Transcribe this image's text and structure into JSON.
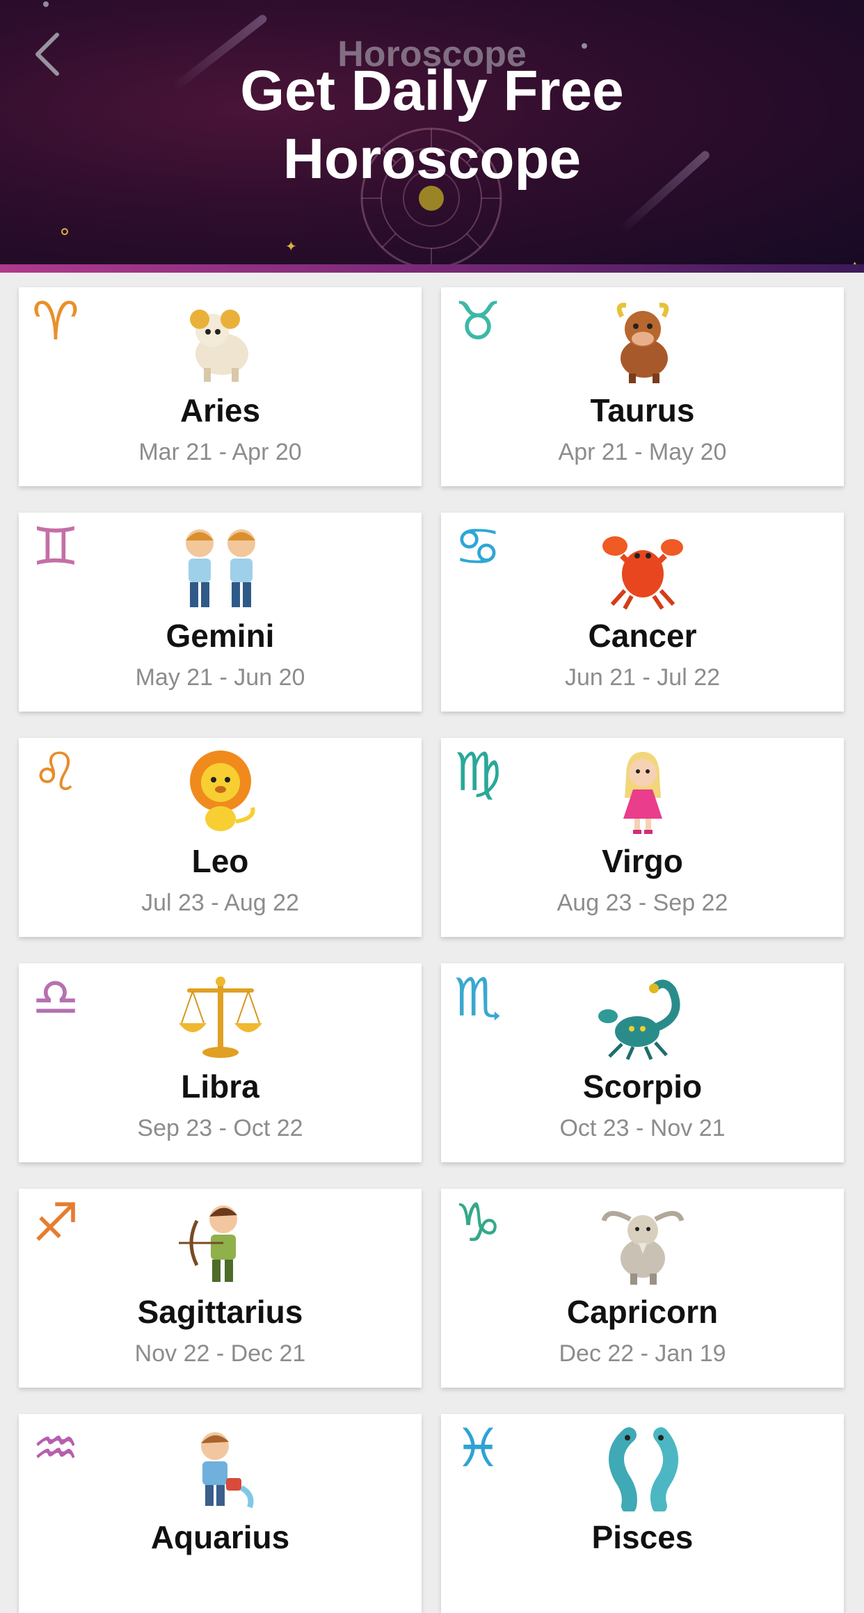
{
  "header": {
    "title": "Horoscope",
    "promo_line1": "Get Daily Free",
    "promo_line2": "Horoscope",
    "back_icon": "chevron-left-icon"
  },
  "signs": [
    {
      "name": "Aries",
      "dates": "Mar 21 - Apr 20",
      "symbol": "♈",
      "color": "#e8902a"
    },
    {
      "name": "Taurus",
      "dates": "Apr 21 - May 20",
      "symbol": "♉",
      "color": "#3db8a6"
    },
    {
      "name": "Gemini",
      "dates": "May 21 - Jun 20",
      "symbol": "♊",
      "color": "#c46fa6"
    },
    {
      "name": "Cancer",
      "dates": "Jun 21 - Jul 22",
      "symbol": "♋",
      "color": "#2ea6d6"
    },
    {
      "name": "Leo",
      "dates": "Jul 23 - Aug 22",
      "symbol": "♌",
      "color": "#e88c2a"
    },
    {
      "name": "Virgo",
      "dates": "Aug 23 - Sep 22",
      "symbol": "♍",
      "color": "#2aa898"
    },
    {
      "name": "Libra",
      "dates": "Sep 23 - Oct 22",
      "symbol": "♎",
      "color": "#b471b0"
    },
    {
      "name": "Scorpio",
      "dates": "Oct 23 - Nov 21",
      "symbol": "♏",
      "color": "#3aa8cf"
    },
    {
      "name": "Sagittarius",
      "dates": "Nov 22 - Dec 21",
      "symbol": "♐",
      "color": "#e67d2e"
    },
    {
      "name": "Capricorn",
      "dates": "Dec 22 - Jan 19",
      "symbol": "♑",
      "color": "#35a88a"
    },
    {
      "name": "Aquarius",
      "dates": "",
      "symbol": "♒",
      "color": "#b65fae"
    },
    {
      "name": "Pisces",
      "dates": "",
      "symbol": "♓",
      "color": "#2ea3d3"
    }
  ]
}
